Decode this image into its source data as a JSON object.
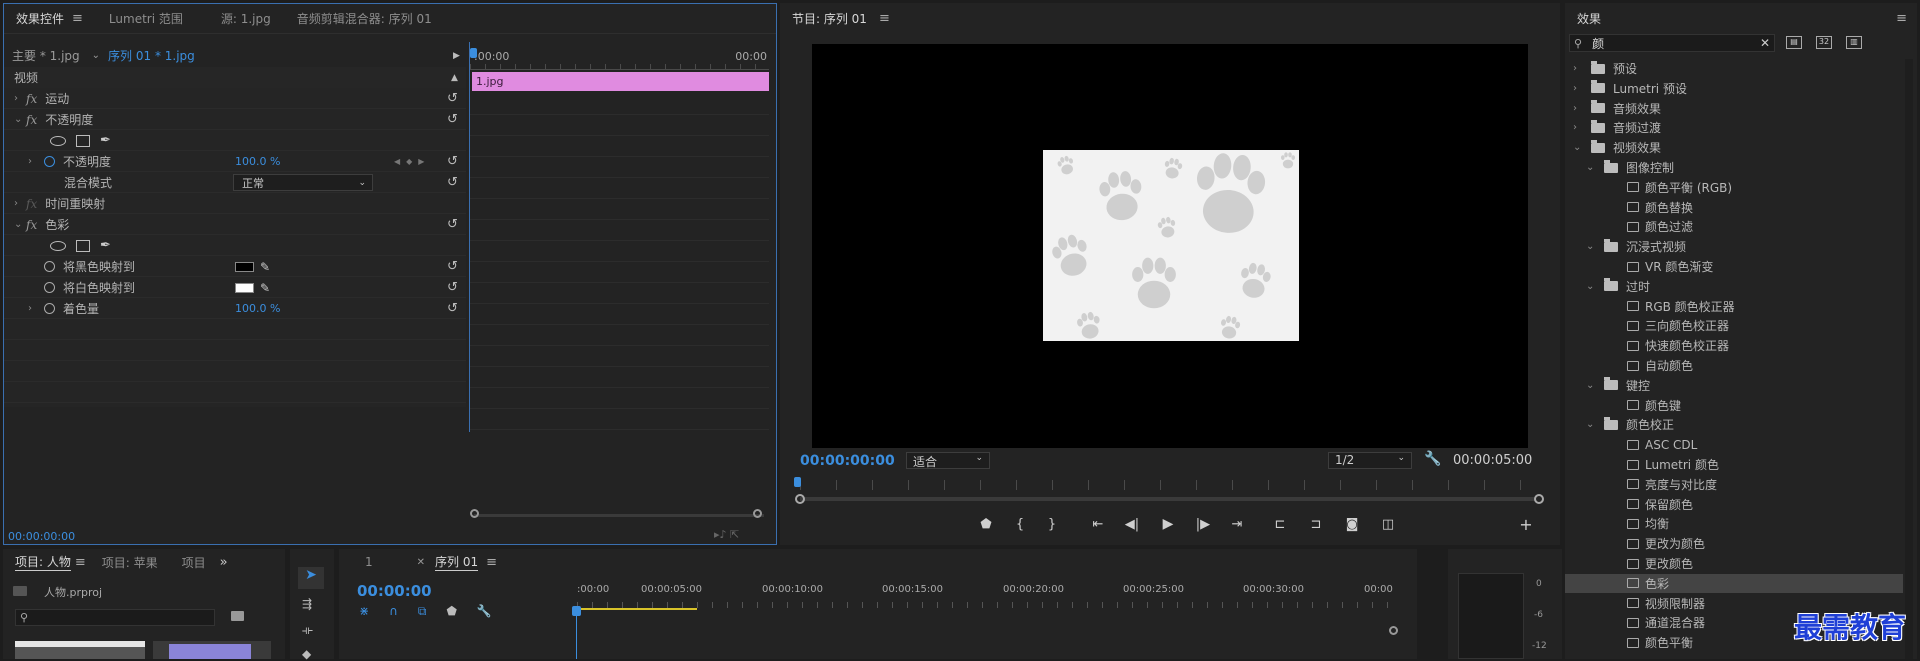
{
  "effect_controls": {
    "tabs": [
      "效果控件",
      "Lumetri 范围",
      "源: 1.jpg",
      "音频剪辑混合器: 序列 01"
    ],
    "master_clip": "主要 * 1.jpg",
    "sequence_clip": "序列 01 * 1.jpg",
    "time_start": ":00:00",
    "time_end": "00:00",
    "clip_name": "1.jpg",
    "section_video": "视频",
    "motion": "运动",
    "opacity_group": "不透明度",
    "opacity_param": "不透明度",
    "opacity_value": "100.0 %",
    "blend_mode_label": "混合模式",
    "blend_mode_value": "正常",
    "time_remap": "时间重映射",
    "color_effect": "色彩",
    "map_black": "将黑色映射到",
    "map_white": "将白色映射到",
    "tint_amount": "着色量",
    "tint_value": "100.0 %",
    "timecode": "00:00:00:00"
  },
  "program": {
    "title": "节目: 序列 01",
    "timecode": "00:00:00:00",
    "fit": "适合",
    "resolution": "1/2",
    "duration": "00:00:05:00"
  },
  "effects": {
    "title": "效果",
    "search_value": "颜",
    "items": [
      {
        "type": "folder",
        "level": 0,
        "label": "预设",
        "expanded": false
      },
      {
        "type": "folder",
        "level": 0,
        "label": "Lumetri 预设",
        "expanded": false
      },
      {
        "type": "folder",
        "level": 0,
        "label": "音频效果",
        "expanded": false
      },
      {
        "type": "folder",
        "level": 0,
        "label": "音频过渡",
        "expanded": false
      },
      {
        "type": "folder",
        "level": 0,
        "label": "视频效果",
        "expanded": true
      },
      {
        "type": "folder",
        "level": 1,
        "label": "图像控制",
        "expanded": true
      },
      {
        "type": "effect",
        "level": 2,
        "label": "颜色平衡 (RGB)"
      },
      {
        "type": "effect",
        "level": 2,
        "label": "颜色替换"
      },
      {
        "type": "effect",
        "level": 2,
        "label": "颜色过滤"
      },
      {
        "type": "folder",
        "level": 1,
        "label": "沉浸式视频",
        "expanded": true
      },
      {
        "type": "effect",
        "level": 2,
        "label": "VR 颜色渐变"
      },
      {
        "type": "folder",
        "level": 1,
        "label": "过时",
        "expanded": true
      },
      {
        "type": "effect",
        "level": 2,
        "label": "RGB 颜色校正器"
      },
      {
        "type": "effect",
        "level": 2,
        "label": "三向颜色校正器"
      },
      {
        "type": "effect",
        "level": 2,
        "label": "快速颜色校正器"
      },
      {
        "type": "effect",
        "level": 2,
        "label": "自动颜色"
      },
      {
        "type": "folder",
        "level": 1,
        "label": "键控",
        "expanded": true
      },
      {
        "type": "effect",
        "level": 2,
        "label": "颜色键"
      },
      {
        "type": "folder",
        "level": 1,
        "label": "颜色校正",
        "expanded": true
      },
      {
        "type": "effect",
        "level": 2,
        "label": "ASC CDL"
      },
      {
        "type": "effect",
        "level": 2,
        "label": "Lumetri 颜色"
      },
      {
        "type": "effect",
        "level": 2,
        "label": "亮度与对比度"
      },
      {
        "type": "effect",
        "level": 2,
        "label": "保留颜色"
      },
      {
        "type": "effect",
        "level": 2,
        "label": "均衡"
      },
      {
        "type": "effect",
        "level": 2,
        "label": "更改为颜色"
      },
      {
        "type": "effect",
        "level": 2,
        "label": "更改颜色"
      },
      {
        "type": "effect",
        "level": 2,
        "label": "色彩",
        "selected": true
      },
      {
        "type": "effect",
        "level": 2,
        "label": "视频限制器"
      },
      {
        "type": "effect",
        "level": 2,
        "label": "通道混合器"
      },
      {
        "type": "effect",
        "level": 2,
        "label": "颜色平衡"
      }
    ]
  },
  "project": {
    "tabs": [
      "项目: 人物",
      "项目: 苹果",
      "项目"
    ],
    "file": "人物.prproj"
  },
  "timeline": {
    "tab_num": "1",
    "tab_seq": "序列 01",
    "timecode": "00:00:00",
    "ruler": [
      ":00:00",
      "00:00:05:00",
      "00:00:10:00",
      "00:00:15:00",
      "00:00:20:00",
      "00:00:25:00",
      "00:00:30:00",
      "00:00"
    ]
  },
  "audio_meter": {
    "labels": [
      "0",
      "-6",
      "-12"
    ]
  },
  "watermark": "最需教育",
  "colors": {
    "accent": "#3b8ede",
    "clip": "#e08be0",
    "panel": "#232323"
  }
}
